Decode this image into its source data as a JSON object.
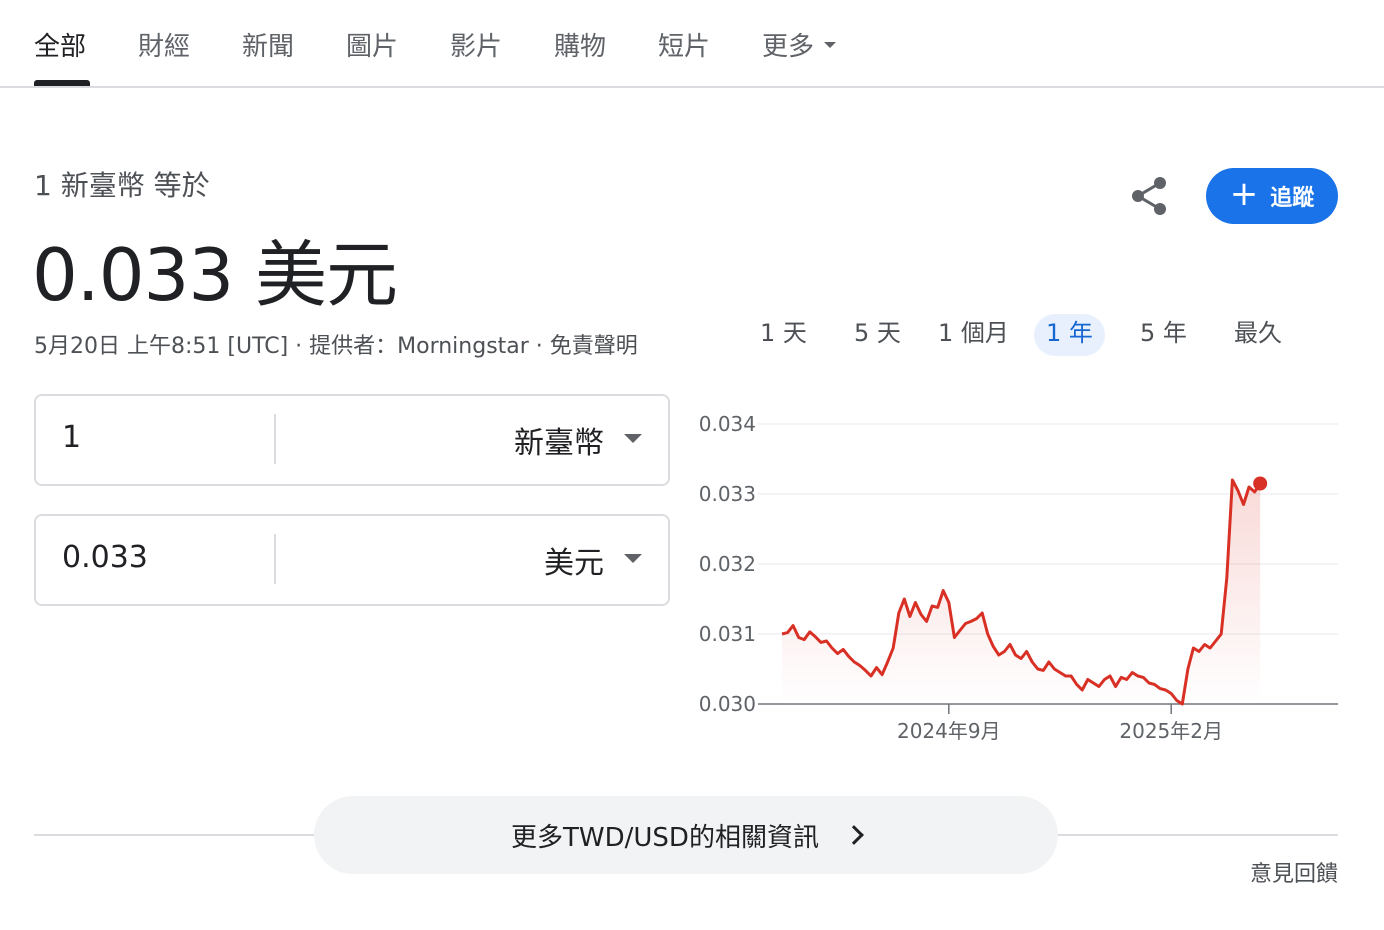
{
  "tabs": [
    {
      "label": "全部",
      "active": true
    },
    {
      "label": "財經"
    },
    {
      "label": "新聞"
    },
    {
      "label": "圖片"
    },
    {
      "label": "影片"
    },
    {
      "label": "購物"
    },
    {
      "label": "短片"
    },
    {
      "label": "更多"
    }
  ],
  "converter": {
    "from_label": "1 新臺幣 等於",
    "to_value": "0.033 美元",
    "meta": "5月20日 上午8:51 [UTC] · 提供者：Morningstar · 免責聲明",
    "from_amount": "1",
    "from_currency": "新臺幣",
    "to_amount": "0.033",
    "to_currency": "美元"
  },
  "actions": {
    "share_icon": "share-icon",
    "follow_label": "追蹤",
    "follow_icon": "plus-icon"
  },
  "ranges": [
    {
      "label": "1 天"
    },
    {
      "label": "5 天"
    },
    {
      "label": "1 個月"
    },
    {
      "label": "1 年",
      "active": true
    },
    {
      "label": "5 年"
    },
    {
      "label": "最久"
    }
  ],
  "chart_data": {
    "type": "line",
    "title": "",
    "xlabel": "",
    "ylabel": "",
    "ylim": [
      0.03,
      0.034
    ],
    "yticks": [
      "0.030",
      "0.031",
      "0.032",
      "0.033",
      "0.034"
    ],
    "xticks": [
      {
        "label": "2024年9月",
        "t": 0.3
      },
      {
        "label": "2025年2月",
        "t": 0.7
      }
    ],
    "grid": true,
    "line_color": "#d93025",
    "series": [
      {
        "values": [
          [
            0.0,
            0.031
          ],
          [
            0.01,
            0.03102
          ],
          [
            0.02,
            0.03112
          ],
          [
            0.03,
            0.03095
          ],
          [
            0.04,
            0.03092
          ],
          [
            0.05,
            0.03103
          ],
          [
            0.06,
            0.03096
          ],
          [
            0.07,
            0.03088
          ],
          [
            0.08,
            0.0309
          ],
          [
            0.09,
            0.0308
          ],
          [
            0.1,
            0.03072
          ],
          [
            0.11,
            0.03078
          ],
          [
            0.12,
            0.03068
          ],
          [
            0.13,
            0.0306
          ],
          [
            0.14,
            0.03055
          ],
          [
            0.15,
            0.03048
          ],
          [
            0.16,
            0.0304
          ],
          [
            0.17,
            0.03052
          ],
          [
            0.18,
            0.03042
          ],
          [
            0.19,
            0.0306
          ],
          [
            0.2,
            0.0308
          ],
          [
            0.21,
            0.0313
          ],
          [
            0.22,
            0.0315
          ],
          [
            0.23,
            0.03125
          ],
          [
            0.24,
            0.03145
          ],
          [
            0.25,
            0.03128
          ],
          [
            0.26,
            0.03118
          ],
          [
            0.27,
            0.0314
          ],
          [
            0.28,
            0.03138
          ],
          [
            0.29,
            0.03162
          ],
          [
            0.3,
            0.03145
          ],
          [
            0.31,
            0.03095
          ],
          [
            0.32,
            0.03105
          ],
          [
            0.33,
            0.03115
          ],
          [
            0.34,
            0.03118
          ],
          [
            0.35,
            0.03122
          ],
          [
            0.36,
            0.0313
          ],
          [
            0.37,
            0.031
          ],
          [
            0.38,
            0.03082
          ],
          [
            0.39,
            0.0307
          ],
          [
            0.4,
            0.03075
          ],
          [
            0.41,
            0.03085
          ],
          [
            0.42,
            0.0307
          ],
          [
            0.43,
            0.03065
          ],
          [
            0.44,
            0.03075
          ],
          [
            0.45,
            0.0306
          ],
          [
            0.46,
            0.0305
          ],
          [
            0.47,
            0.03048
          ],
          [
            0.48,
            0.0306
          ],
          [
            0.49,
            0.0305
          ],
          [
            0.5,
            0.03045
          ],
          [
            0.51,
            0.0304
          ],
          [
            0.52,
            0.0304
          ],
          [
            0.53,
            0.03028
          ],
          [
            0.54,
            0.0302
          ],
          [
            0.55,
            0.03035
          ],
          [
            0.56,
            0.0303
          ],
          [
            0.57,
            0.03025
          ],
          [
            0.58,
            0.03035
          ],
          [
            0.59,
            0.0304
          ],
          [
            0.6,
            0.03025
          ],
          [
            0.61,
            0.03038
          ],
          [
            0.62,
            0.03035
          ],
          [
            0.63,
            0.03045
          ],
          [
            0.64,
            0.0304
          ],
          [
            0.65,
            0.03038
          ],
          [
            0.66,
            0.0303
          ],
          [
            0.67,
            0.03028
          ],
          [
            0.68,
            0.03022
          ],
          [
            0.69,
            0.0302
          ],
          [
            0.7,
            0.03015
          ],
          [
            0.71,
            0.03005
          ],
          [
            0.72,
            0.03
          ],
          [
            0.73,
            0.0305
          ],
          [
            0.74,
            0.0308
          ],
          [
            0.75,
            0.03075
          ],
          [
            0.76,
            0.03085
          ],
          [
            0.77,
            0.0308
          ],
          [
            0.78,
            0.0309
          ],
          [
            0.79,
            0.031
          ],
          [
            0.8,
            0.0318
          ],
          [
            0.81,
            0.0332
          ],
          [
            0.82,
            0.03305
          ],
          [
            0.83,
            0.03285
          ],
          [
            0.84,
            0.0331
          ],
          [
            0.85,
            0.03303
          ],
          [
            0.86,
            0.03315
          ]
        ]
      }
    ]
  },
  "footer": {
    "more_label": "更多TWD/USD的相關資訊",
    "feedback_label": "意見回饋"
  }
}
